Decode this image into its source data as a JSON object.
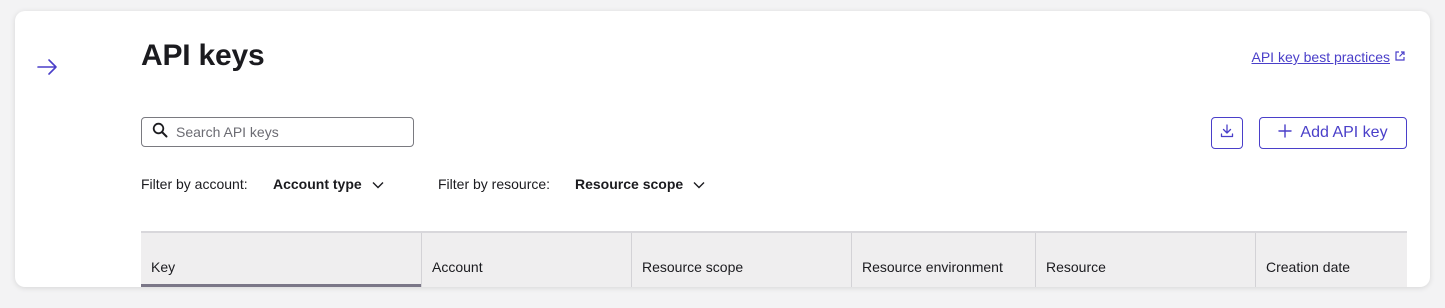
{
  "page": {
    "title": "API keys",
    "best_practices_link": "API key best practices"
  },
  "search": {
    "placeholder": "Search API keys",
    "value": ""
  },
  "toolbar": {
    "add_label": "Add API key"
  },
  "filters": {
    "account": {
      "label": "Filter by account:",
      "value": "Account type"
    },
    "resource": {
      "label": "Filter by resource:",
      "value": "Resource scope"
    }
  },
  "table": {
    "columns": [
      "Key",
      "Account",
      "Resource scope",
      "Resource environment",
      "Resource",
      "Creation date"
    ],
    "sorted_column": "Key"
  },
  "colors": {
    "accent": "#4a3fc9",
    "header_bg": "#efeeef"
  }
}
